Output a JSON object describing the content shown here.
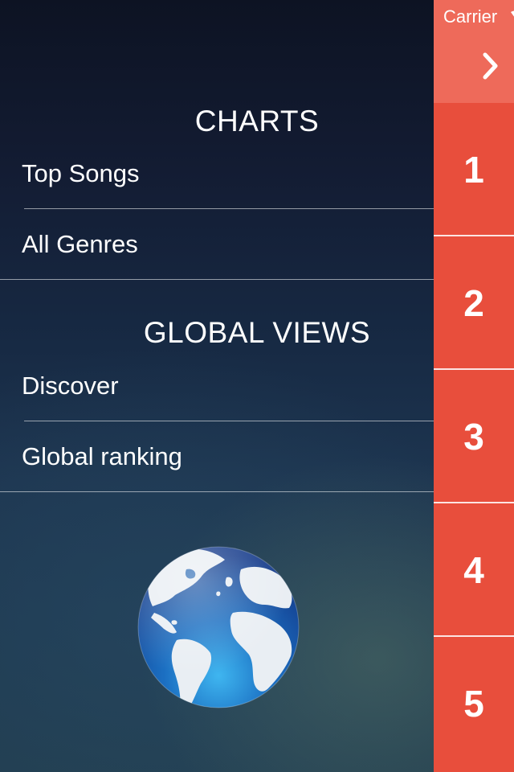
{
  "drawer": {
    "charts_section": {
      "title": "CHARTS",
      "items": [
        {
          "label": "Top Songs"
        },
        {
          "label": "All Genres"
        }
      ]
    },
    "global_section": {
      "title": "GLOBAL VIEWS",
      "items": [
        {
          "label": "Discover"
        },
        {
          "label": "Global ranking"
        }
      ]
    },
    "globe_icon": "globe-icon"
  },
  "main": {
    "status": {
      "carrier": "Carrier"
    },
    "header_icon": "chevron-right-icon",
    "rows": [
      {
        "rank": "1"
      },
      {
        "rank": "2"
      },
      {
        "rank": "3"
      },
      {
        "rank": "4"
      },
      {
        "rank": "5"
      }
    ]
  },
  "colors": {
    "accent": "#e84e3c",
    "header": "#ee6a5a",
    "drawer_top": "#0d1323",
    "drawer_bottom": "#223e50"
  }
}
